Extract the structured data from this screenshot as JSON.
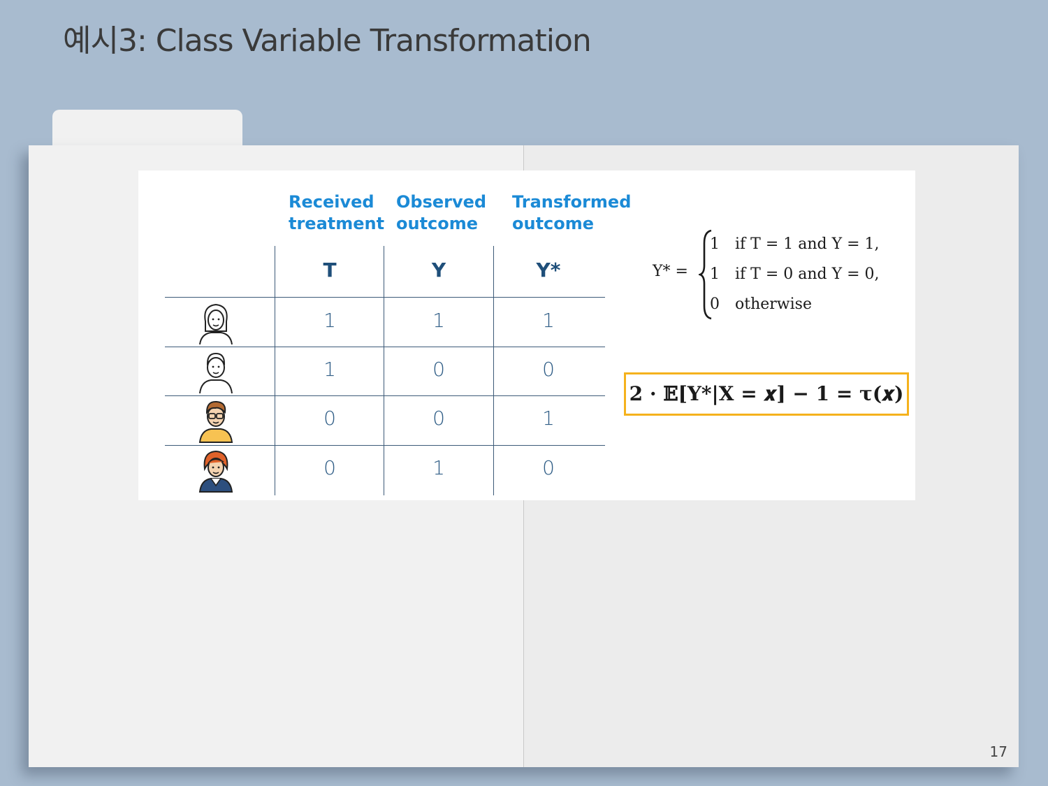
{
  "slide": {
    "title": "예시3: Class Variable Transformation",
    "page_number": "17"
  },
  "table": {
    "column_headers": [
      {
        "line1": "Received",
        "line2": "treatment"
      },
      {
        "line1": "Observed",
        "line2": "outcome"
      },
      {
        "line1": "Transformed",
        "line2": "outcome"
      }
    ],
    "symbols": [
      "T",
      "Y",
      "Y*"
    ],
    "rows": [
      {
        "avatar": "woman-outline-avatar",
        "T": "1",
        "Y": "1",
        "Ystar": "1"
      },
      {
        "avatar": "man-outline-avatar",
        "T": "1",
        "Y": "0",
        "Ystar": "0"
      },
      {
        "avatar": "man-glasses-avatar",
        "T": "0",
        "Y": "0",
        "Ystar": "1"
      },
      {
        "avatar": "redhead-woman-avatar",
        "T": "0",
        "Y": "1",
        "Ystar": "0"
      }
    ],
    "header_color": "#1b8ad6"
  },
  "formula": {
    "lhs": "Y* =",
    "cases": [
      {
        "value": "1",
        "condition": "if T = 1 and Y = 1,"
      },
      {
        "value": "1",
        "condition": "if T = 0 and Y = 0,"
      },
      {
        "value": "0",
        "condition": "otherwise"
      }
    ],
    "boxed": "2 · 𝔼[Y*|X = 𝒙] − 1 = τ(𝒙)",
    "box_color": "#f5b21d"
  }
}
